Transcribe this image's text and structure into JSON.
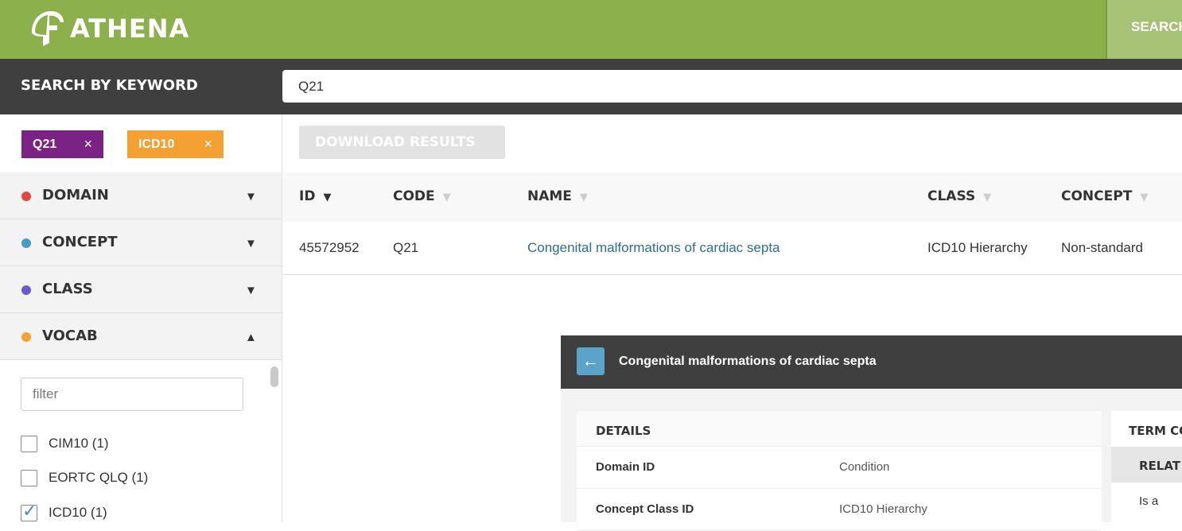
{
  "header": {
    "app_name": "ATHENA",
    "search_button_label": "SEARCH"
  },
  "search": {
    "label": "SEARCH BY KEYWORD",
    "value": "Q21"
  },
  "chips": [
    {
      "label": "Q21",
      "remove": "×",
      "color": "#7b2384"
    },
    {
      "label": "ICD10",
      "remove": "×",
      "color": "#f5a033"
    }
  ],
  "facets": [
    {
      "label": "DOMAIN",
      "dot_color": "#e0473f",
      "arrow": "▼"
    },
    {
      "label": "CONCEPT",
      "dot_color": "#4a9bc4",
      "arrow": "▼"
    },
    {
      "label": "CLASS",
      "dot_color": "#6a5acd",
      "arrow": "▼"
    },
    {
      "label": "VOCAB",
      "dot_color": "#f5a033",
      "arrow": "▲"
    }
  ],
  "vocab_filter": {
    "placeholder": "filter",
    "items": [
      {
        "label": "CIM10 (1)",
        "checked": false
      },
      {
        "label": "EORTC QLQ (1)",
        "checked": false
      },
      {
        "label": "ICD10 (1)",
        "checked": true
      }
    ]
  },
  "toolbar": {
    "download_label": "DOWNLOAD RESULTS"
  },
  "table": {
    "columns": [
      {
        "label": "ID",
        "sort": "▼"
      },
      {
        "label": "CODE",
        "sort": "▼"
      },
      {
        "label": "NAME",
        "sort": "▼"
      },
      {
        "label": "CLASS",
        "sort": "▼"
      },
      {
        "label": "CONCEPT",
        "sort": "▼"
      }
    ],
    "rows": [
      {
        "id": "45572952",
        "code": "Q21",
        "name": "Congenital malformations of cardiac septa",
        "class": "ICD10 Hierarchy",
        "concept": "Non-standard"
      }
    ]
  },
  "detail": {
    "back_icon": "←",
    "title": "Congenital malformations of cardiac septa",
    "details_heading": "DETAILS",
    "fields": [
      {
        "key": "Domain ID",
        "value": "Condition"
      },
      {
        "key": "Concept Class ID",
        "value": "ICD10 Hierarchy"
      }
    ],
    "side_heading": "TERM CO",
    "side_subheading": "RELAT",
    "side_row": "Is a"
  },
  "colors": {
    "header_green": "#8cb04b",
    "dark_bar": "#3f3f3f",
    "link": "#2d6e8f"
  }
}
